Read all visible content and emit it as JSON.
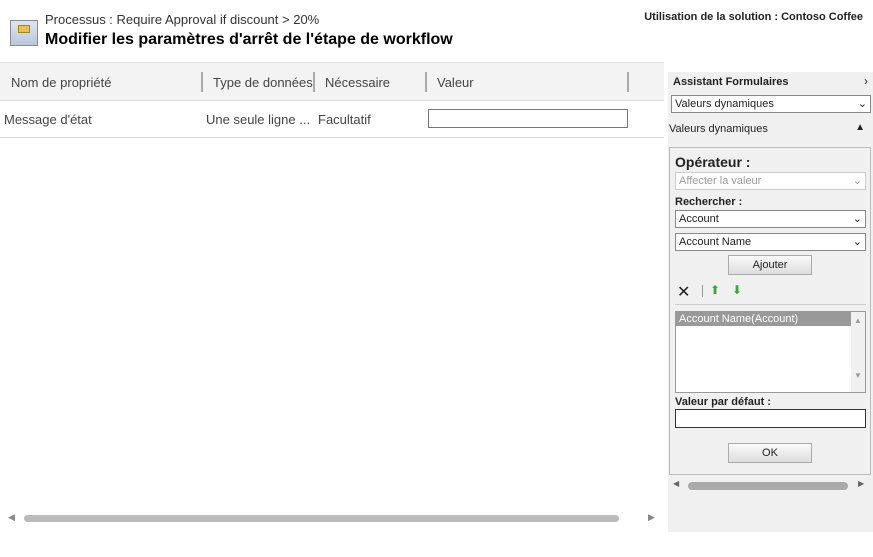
{
  "header": {
    "breadcrumb": "Processus : Require Approval if discount > 20%",
    "title": "Modifier les paramètres d'arrêt de l'étape de workflow",
    "solution": "Utilisation de la solution : Contoso Coffee"
  },
  "grid": {
    "columns": [
      "Nom de propriété",
      "Type de données",
      "Nécessaire",
      "Valeur"
    ],
    "rows": [
      {
        "name": "Message d'état",
        "type": "Une seule ligne ...",
        "required": "Facultatif",
        "value": ""
      }
    ]
  },
  "panel": {
    "title": "Assistant Formulaires",
    "mode_select": "Valeurs dynamiques",
    "section": "Valeurs dynamiques",
    "operator_label": "Opérateur :",
    "operator_value": "Affecter la valeur",
    "search_label": "Rechercher :",
    "entity": "Account",
    "field": "Account Name",
    "add_button": "Ajouter",
    "list_items": [
      "Account Name(Account)"
    ],
    "default_label": "Valeur par défaut :",
    "default_value": "",
    "ok_button": "OK"
  }
}
